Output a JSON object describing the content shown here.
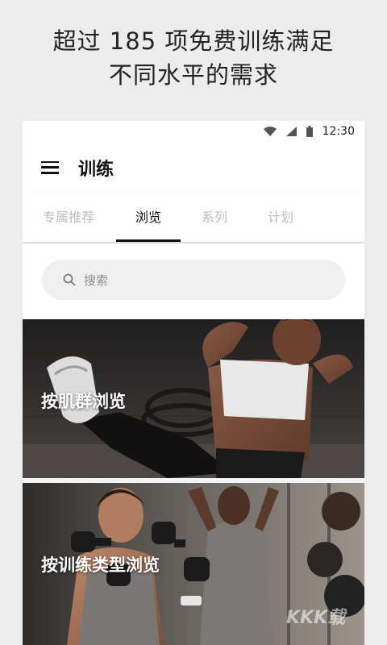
{
  "promo": {
    "line1": "超过 185 项免费训练满足",
    "line2": "不同水平的需求"
  },
  "status_bar": {
    "time": "12:30",
    "icons": [
      "wifi-icon",
      "signal-icon",
      "battery-icon"
    ]
  },
  "app_bar": {
    "title": "训练",
    "menu_icon": "hamburger-menu-icon"
  },
  "tabs": [
    {
      "label": "专属推荐",
      "active": false
    },
    {
      "label": "浏览",
      "active": true
    },
    {
      "label": "系列",
      "active": false
    },
    {
      "label": "计划",
      "active": false
    }
  ],
  "search": {
    "placeholder": "搜索",
    "icon": "search-icon"
  },
  "cards": [
    {
      "label": "按肌群浏览"
    },
    {
      "label": "按训练类型浏览"
    }
  ],
  "watermark": "KKK载",
  "colors": {
    "background": "#ececec",
    "active_tab": "#111111",
    "inactive_tab": "#bdbdbd"
  }
}
